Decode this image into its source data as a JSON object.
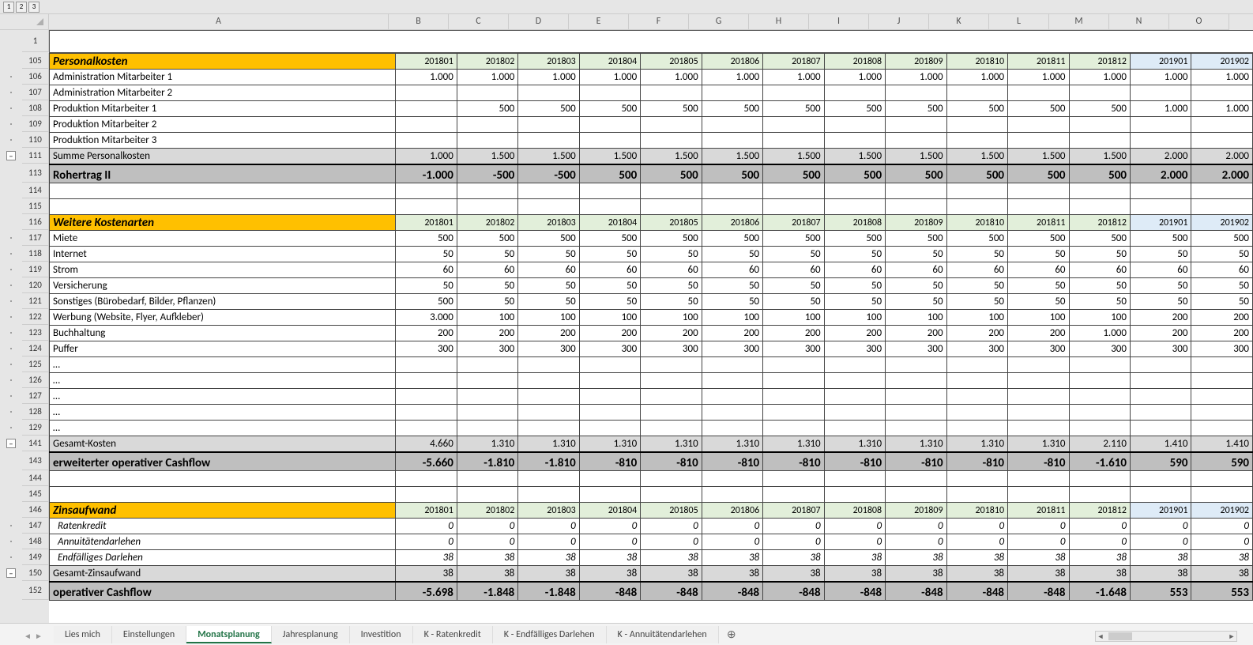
{
  "outline_levels": [
    "1",
    "2",
    "3"
  ],
  "col_letters": [
    "A",
    "B",
    "C",
    "D",
    "E",
    "F",
    "G",
    "H",
    "I",
    "J",
    "K",
    "L",
    "M",
    "N",
    "O"
  ],
  "periods_header": [
    "201801",
    "201802",
    "201803",
    "201804",
    "201805",
    "201806",
    "201807",
    "201808",
    "201809",
    "201810",
    "201811",
    "201812",
    "201901",
    "201902"
  ],
  "frozen_row_num": "1",
  "rows": [
    {
      "n": "105",
      "type": "section",
      "label": "Personalkosten",
      "periods": [
        "201801",
        "201802",
        "201803",
        "201804",
        "201805",
        "201806",
        "201807",
        "201808",
        "201809",
        "201810",
        "201811",
        "201812",
        "201901",
        "201902"
      ]
    },
    {
      "n": "106",
      "label": "Administration Mitarbeiter 1",
      "v": [
        "1.000",
        "1.000",
        "1.000",
        "1.000",
        "1.000",
        "1.000",
        "1.000",
        "1.000",
        "1.000",
        "1.000",
        "1.000",
        "1.000",
        "1.000",
        "1.000"
      ]
    },
    {
      "n": "107",
      "label": "Administration Mitarbeiter 2",
      "v": [
        "",
        "",
        "",
        "",
        "",
        "",
        "",
        "",
        "",
        "",
        "",
        "",
        "",
        ""
      ]
    },
    {
      "n": "108",
      "label": "Produktion Mitarbeiter 1",
      "v": [
        "",
        "500",
        "500",
        "500",
        "500",
        "500",
        "500",
        "500",
        "500",
        "500",
        "500",
        "500",
        "1.000",
        "1.000"
      ]
    },
    {
      "n": "109",
      "label": "Produktion Mitarbeiter 2",
      "v": [
        "",
        "",
        "",
        "",
        "",
        "",
        "",
        "",
        "",
        "",
        "",
        "",
        "",
        ""
      ]
    },
    {
      "n": "110",
      "label": "Produktion Mitarbeiter 3",
      "v": [
        "",
        "",
        "",
        "",
        "",
        "",
        "",
        "",
        "",
        "",
        "",
        "",
        "",
        ""
      ]
    },
    {
      "n": "111",
      "type": "sum",
      "label": "Summe Personalkosten",
      "v": [
        "1.000",
        "1.500",
        "1.500",
        "1.500",
        "1.500",
        "1.500",
        "1.500",
        "1.500",
        "1.500",
        "1.500",
        "1.500",
        "1.500",
        "2.000",
        "2.000"
      ]
    },
    {
      "n": "113",
      "type": "boldsum",
      "label": "Rohertrag II",
      "v": [
        "-1.000",
        "-500",
        "-500",
        "500",
        "500",
        "500",
        "500",
        "500",
        "500",
        "500",
        "500",
        "500",
        "2.000",
        "2.000"
      ]
    },
    {
      "n": "114",
      "label": "",
      "v": [
        "",
        "",
        "",
        "",
        "",
        "",
        "",
        "",
        "",
        "",
        "",
        "",
        "",
        ""
      ]
    },
    {
      "n": "115",
      "label": "",
      "v": [
        "",
        "",
        "",
        "",
        "",
        "",
        "",
        "",
        "",
        "",
        "",
        "",
        "",
        ""
      ]
    },
    {
      "n": "116",
      "type": "section",
      "label": "Weitere Kostenarten",
      "periods": [
        "201801",
        "201802",
        "201803",
        "201804",
        "201805",
        "201806",
        "201807",
        "201808",
        "201809",
        "201810",
        "201811",
        "201812",
        "201901",
        "201902"
      ]
    },
    {
      "n": "117",
      "label": "Miete",
      "v": [
        "500",
        "500",
        "500",
        "500",
        "500",
        "500",
        "500",
        "500",
        "500",
        "500",
        "500",
        "500",
        "500",
        "500"
      ]
    },
    {
      "n": "118",
      "label": "Internet",
      "v": [
        "50",
        "50",
        "50",
        "50",
        "50",
        "50",
        "50",
        "50",
        "50",
        "50",
        "50",
        "50",
        "50",
        "50"
      ]
    },
    {
      "n": "119",
      "label": "Strom",
      "v": [
        "60",
        "60",
        "60",
        "60",
        "60",
        "60",
        "60",
        "60",
        "60",
        "60",
        "60",
        "60",
        "60",
        "60"
      ]
    },
    {
      "n": "120",
      "label": "Versicherung",
      "v": [
        "50",
        "50",
        "50",
        "50",
        "50",
        "50",
        "50",
        "50",
        "50",
        "50",
        "50",
        "50",
        "50",
        "50"
      ]
    },
    {
      "n": "121",
      "label": "Sonstiges (Bürobedarf, Bilder, Pflanzen)",
      "v": [
        "500",
        "50",
        "50",
        "50",
        "50",
        "50",
        "50",
        "50",
        "50",
        "50",
        "50",
        "50",
        "50",
        "50"
      ]
    },
    {
      "n": "122",
      "label": "Werbung (Website, Flyer, Aufkleber)",
      "v": [
        "3.000",
        "100",
        "100",
        "100",
        "100",
        "100",
        "100",
        "100",
        "100",
        "100",
        "100",
        "100",
        "200",
        "200"
      ]
    },
    {
      "n": "123",
      "label": "Buchhaltung",
      "v": [
        "200",
        "200",
        "200",
        "200",
        "200",
        "200",
        "200",
        "200",
        "200",
        "200",
        "200",
        "1.000",
        "200",
        "200"
      ]
    },
    {
      "n": "124",
      "label": "Puffer",
      "v": [
        "300",
        "300",
        "300",
        "300",
        "300",
        "300",
        "300",
        "300",
        "300",
        "300",
        "300",
        "300",
        "300",
        "300"
      ]
    },
    {
      "n": "125",
      "label": "…",
      "v": [
        "",
        "",
        "",
        "",
        "",
        "",
        "",
        "",
        "",
        "",
        "",
        "",
        "",
        ""
      ]
    },
    {
      "n": "126",
      "label": "…",
      "v": [
        "",
        "",
        "",
        "",
        "",
        "",
        "",
        "",
        "",
        "",
        "",
        "",
        "",
        ""
      ]
    },
    {
      "n": "127",
      "label": "…",
      "v": [
        "",
        "",
        "",
        "",
        "",
        "",
        "",
        "",
        "",
        "",
        "",
        "",
        "",
        ""
      ]
    },
    {
      "n": "128",
      "label": "…",
      "v": [
        "",
        "",
        "",
        "",
        "",
        "",
        "",
        "",
        "",
        "",
        "",
        "",
        "",
        ""
      ]
    },
    {
      "n": "129",
      "label": "…",
      "v": [
        "",
        "",
        "",
        "",
        "",
        "",
        "",
        "",
        "",
        "",
        "",
        "",
        "",
        ""
      ]
    },
    {
      "n": "141",
      "type": "sum",
      "label": "Gesamt-Kosten",
      "v": [
        "4.660",
        "1.310",
        "1.310",
        "1.310",
        "1.310",
        "1.310",
        "1.310",
        "1.310",
        "1.310",
        "1.310",
        "1.310",
        "2.110",
        "1.410",
        "1.410"
      ]
    },
    {
      "n": "143",
      "type": "boldsum",
      "label": "erweiterter operativer Cashflow",
      "v": [
        "-5.660",
        "-1.810",
        "-1.810",
        "-810",
        "-810",
        "-810",
        "-810",
        "-810",
        "-810",
        "-810",
        "-810",
        "-1.610",
        "590",
        "590"
      ]
    },
    {
      "n": "144",
      "label": "",
      "v": [
        "",
        "",
        "",
        "",
        "",
        "",
        "",
        "",
        "",
        "",
        "",
        "",
        "",
        ""
      ]
    },
    {
      "n": "145",
      "label": "",
      "v": [
        "",
        "",
        "",
        "",
        "",
        "",
        "",
        "",
        "",
        "",
        "",
        "",
        "",
        ""
      ]
    },
    {
      "n": "146",
      "type": "section",
      "label": "Zinsaufwand",
      "periods": [
        "201801",
        "201802",
        "201803",
        "201804",
        "201805",
        "201806",
        "201807",
        "201808",
        "201809",
        "201810",
        "201811",
        "201812",
        "201901",
        "201902"
      ]
    },
    {
      "n": "147",
      "type": "ital",
      "label": "Ratenkredit",
      "v": [
        "0",
        "0",
        "0",
        "0",
        "0",
        "0",
        "0",
        "0",
        "0",
        "0",
        "0",
        "0",
        "0",
        "0"
      ]
    },
    {
      "n": "148",
      "type": "ital",
      "label": "Annuitätendarlehen",
      "v": [
        "0",
        "0",
        "0",
        "0",
        "0",
        "0",
        "0",
        "0",
        "0",
        "0",
        "0",
        "0",
        "0",
        "0"
      ]
    },
    {
      "n": "149",
      "type": "ital",
      "label": "Endfälliges Darlehen",
      "v": [
        "38",
        "38",
        "38",
        "38",
        "38",
        "38",
        "38",
        "38",
        "38",
        "38",
        "38",
        "38",
        "38",
        "38"
      ]
    },
    {
      "n": "150",
      "type": "sum",
      "label": "Gesamt-Zinsaufwand",
      "v": [
        "38",
        "38",
        "38",
        "38",
        "38",
        "38",
        "38",
        "38",
        "38",
        "38",
        "38",
        "38",
        "38",
        "38"
      ]
    },
    {
      "n": "152",
      "type": "boldsum",
      "label": "operativer Cashflow",
      "v": [
        "-5.698",
        "-1.848",
        "-1.848",
        "-848",
        "-848",
        "-848",
        "-848",
        "-848",
        "-848",
        "-848",
        "-848",
        "-1.648",
        "553",
        "553"
      ]
    }
  ],
  "outline_collapse_rows": [
    "111",
    "141",
    "150"
  ],
  "sheet_tabs": [
    "Lies mich",
    "Einstellungen",
    "Monatsplanung",
    "Jahresplanung",
    "Investition",
    "K - Ratenkredit",
    "K - Endfälliges Darlehen",
    "K - Annuitätendarlehen"
  ],
  "active_tab_index": 2,
  "add_sheet_glyph": "⊕",
  "col_widths": {
    "A": 430,
    "data": 76
  }
}
